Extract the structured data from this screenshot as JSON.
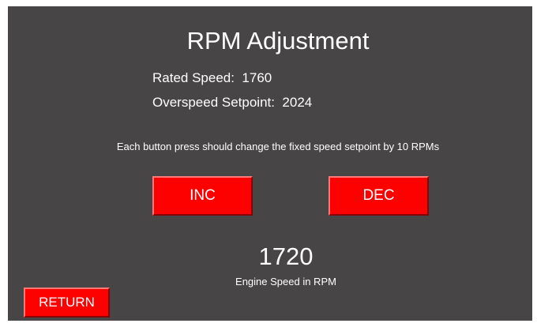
{
  "screen": {
    "title": "RPM Adjustment",
    "rated_speed": "Rated Speed:  1760",
    "overspeed_setpoint": "Overspeed Setpoint:  2024",
    "note": "Each button press should change the fixed speed setpoint by 10 RPMs",
    "engine_speed_value": "1720",
    "engine_speed_label": "Engine Speed in RPM"
  },
  "buttons": {
    "inc_label": "INC",
    "dec_label": "DEC",
    "return_label": "RETURN"
  },
  "colors": {
    "background": "#474545",
    "button": "#fd0000",
    "text": "#ffffff"
  }
}
